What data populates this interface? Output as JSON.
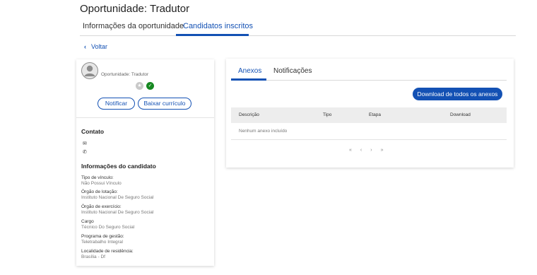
{
  "header": {
    "title": "Oportunidade: Tradutor"
  },
  "top_tabs": [
    {
      "label": "Informações da oportunidade",
      "active": false
    },
    {
      "label": "Candidatos inscritos",
      "active": true
    }
  ],
  "back": {
    "label": "Voltar"
  },
  "candidate": {
    "opportunity_label": "Oportunidade: Tradutor",
    "buttons": {
      "notify": "Notificar",
      "download_cv": "Baixar currículo"
    },
    "contact_heading": "Contato",
    "info_heading": "Informações do candidato",
    "fields": [
      {
        "label": "Tipo de vínculo:",
        "value": "Não Possui Vínculo"
      },
      {
        "label": "Órgão de lotação:",
        "value": "Instituto Nacional De Seguro Social"
      },
      {
        "label": "Órgão de exercício:",
        "value": "Instituto Nacional De Seguro Social"
      },
      {
        "label": "Cargo",
        "value": "Técnico Do Seguro Social"
      },
      {
        "label": "Programa de gestão:",
        "value": "Teletrabalho Integral"
      },
      {
        "label": "Localidade de residência:",
        "value": "Brasília - Df"
      }
    ]
  },
  "panel": {
    "tabs": [
      {
        "label": "Anexos",
        "active": true
      },
      {
        "label": "Notificações",
        "active": false
      }
    ],
    "download_all_label": "Download de todos os anexos",
    "columns": [
      "Descrição",
      "Tipo",
      "Etapa",
      "Download"
    ],
    "empty_message": "Nenhum anexo incluído",
    "pager": [
      "«",
      "‹",
      "›",
      "»"
    ]
  },
  "colors": {
    "accent": "#1351b4",
    "success": "#168821"
  }
}
